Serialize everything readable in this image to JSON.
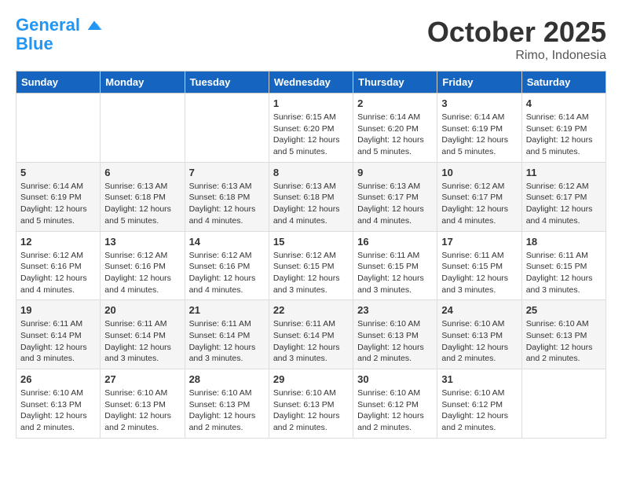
{
  "header": {
    "logo_line1": "General",
    "logo_line2": "Blue",
    "month": "October 2025",
    "location": "Rimo, Indonesia"
  },
  "days_of_week": [
    "Sunday",
    "Monday",
    "Tuesday",
    "Wednesday",
    "Thursday",
    "Friday",
    "Saturday"
  ],
  "weeks": [
    [
      {
        "day": "",
        "info": ""
      },
      {
        "day": "",
        "info": ""
      },
      {
        "day": "",
        "info": ""
      },
      {
        "day": "1",
        "info": "Sunrise: 6:15 AM\nSunset: 6:20 PM\nDaylight: 12 hours and 5 minutes."
      },
      {
        "day": "2",
        "info": "Sunrise: 6:14 AM\nSunset: 6:20 PM\nDaylight: 12 hours and 5 minutes."
      },
      {
        "day": "3",
        "info": "Sunrise: 6:14 AM\nSunset: 6:19 PM\nDaylight: 12 hours and 5 minutes."
      },
      {
        "day": "4",
        "info": "Sunrise: 6:14 AM\nSunset: 6:19 PM\nDaylight: 12 hours and 5 minutes."
      }
    ],
    [
      {
        "day": "5",
        "info": "Sunrise: 6:14 AM\nSunset: 6:19 PM\nDaylight: 12 hours and 5 minutes."
      },
      {
        "day": "6",
        "info": "Sunrise: 6:13 AM\nSunset: 6:18 PM\nDaylight: 12 hours and 5 minutes."
      },
      {
        "day": "7",
        "info": "Sunrise: 6:13 AM\nSunset: 6:18 PM\nDaylight: 12 hours and 4 minutes."
      },
      {
        "day": "8",
        "info": "Sunrise: 6:13 AM\nSunset: 6:18 PM\nDaylight: 12 hours and 4 minutes."
      },
      {
        "day": "9",
        "info": "Sunrise: 6:13 AM\nSunset: 6:17 PM\nDaylight: 12 hours and 4 minutes."
      },
      {
        "day": "10",
        "info": "Sunrise: 6:12 AM\nSunset: 6:17 PM\nDaylight: 12 hours and 4 minutes."
      },
      {
        "day": "11",
        "info": "Sunrise: 6:12 AM\nSunset: 6:17 PM\nDaylight: 12 hours and 4 minutes."
      }
    ],
    [
      {
        "day": "12",
        "info": "Sunrise: 6:12 AM\nSunset: 6:16 PM\nDaylight: 12 hours and 4 minutes."
      },
      {
        "day": "13",
        "info": "Sunrise: 6:12 AM\nSunset: 6:16 PM\nDaylight: 12 hours and 4 minutes."
      },
      {
        "day": "14",
        "info": "Sunrise: 6:12 AM\nSunset: 6:16 PM\nDaylight: 12 hours and 4 minutes."
      },
      {
        "day": "15",
        "info": "Sunrise: 6:12 AM\nSunset: 6:15 PM\nDaylight: 12 hours and 3 minutes."
      },
      {
        "day": "16",
        "info": "Sunrise: 6:11 AM\nSunset: 6:15 PM\nDaylight: 12 hours and 3 minutes."
      },
      {
        "day": "17",
        "info": "Sunrise: 6:11 AM\nSunset: 6:15 PM\nDaylight: 12 hours and 3 minutes."
      },
      {
        "day": "18",
        "info": "Sunrise: 6:11 AM\nSunset: 6:15 PM\nDaylight: 12 hours and 3 minutes."
      }
    ],
    [
      {
        "day": "19",
        "info": "Sunrise: 6:11 AM\nSunset: 6:14 PM\nDaylight: 12 hours and 3 minutes."
      },
      {
        "day": "20",
        "info": "Sunrise: 6:11 AM\nSunset: 6:14 PM\nDaylight: 12 hours and 3 minutes."
      },
      {
        "day": "21",
        "info": "Sunrise: 6:11 AM\nSunset: 6:14 PM\nDaylight: 12 hours and 3 minutes."
      },
      {
        "day": "22",
        "info": "Sunrise: 6:11 AM\nSunset: 6:14 PM\nDaylight: 12 hours and 3 minutes."
      },
      {
        "day": "23",
        "info": "Sunrise: 6:10 AM\nSunset: 6:13 PM\nDaylight: 12 hours and 2 minutes."
      },
      {
        "day": "24",
        "info": "Sunrise: 6:10 AM\nSunset: 6:13 PM\nDaylight: 12 hours and 2 minutes."
      },
      {
        "day": "25",
        "info": "Sunrise: 6:10 AM\nSunset: 6:13 PM\nDaylight: 12 hours and 2 minutes."
      }
    ],
    [
      {
        "day": "26",
        "info": "Sunrise: 6:10 AM\nSunset: 6:13 PM\nDaylight: 12 hours and 2 minutes."
      },
      {
        "day": "27",
        "info": "Sunrise: 6:10 AM\nSunset: 6:13 PM\nDaylight: 12 hours and 2 minutes."
      },
      {
        "day": "28",
        "info": "Sunrise: 6:10 AM\nSunset: 6:13 PM\nDaylight: 12 hours and 2 minutes."
      },
      {
        "day": "29",
        "info": "Sunrise: 6:10 AM\nSunset: 6:13 PM\nDaylight: 12 hours and 2 minutes."
      },
      {
        "day": "30",
        "info": "Sunrise: 6:10 AM\nSunset: 6:12 PM\nDaylight: 12 hours and 2 minutes."
      },
      {
        "day": "31",
        "info": "Sunrise: 6:10 AM\nSunset: 6:12 PM\nDaylight: 12 hours and 2 minutes."
      },
      {
        "day": "",
        "info": ""
      }
    ]
  ]
}
